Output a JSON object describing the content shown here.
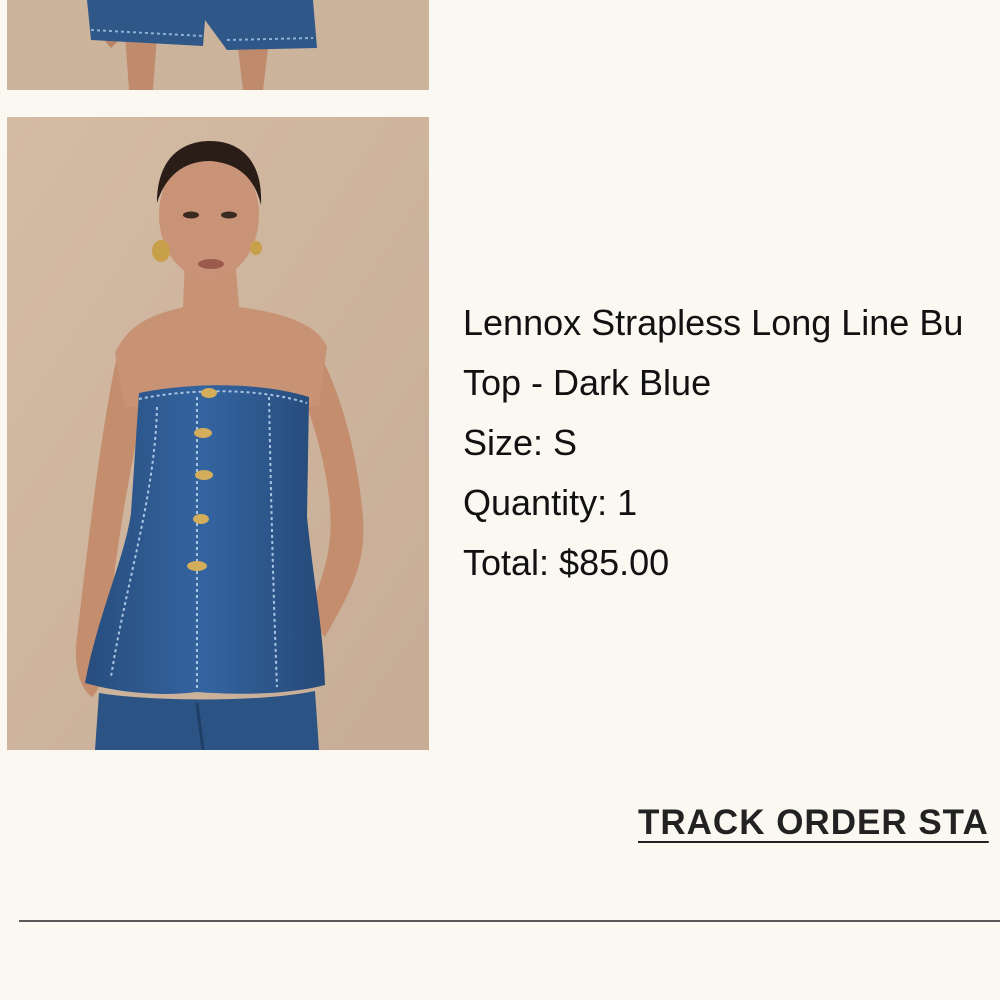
{
  "order_item": {
    "title_line_1": "Lennox Strapless Long Line Bu",
    "title_line_2": "Top - Dark Blue",
    "size_text": "Size: S",
    "quantity_text": "Quantity: 1",
    "total_text": "Total: $85.00"
  },
  "actions": {
    "track_label": "TRACK ORDER STA"
  },
  "colors": {
    "page_background": "#faf8f1",
    "photo_background": "#cdb6a0",
    "denim": "#2d5586",
    "text": "#111111"
  }
}
